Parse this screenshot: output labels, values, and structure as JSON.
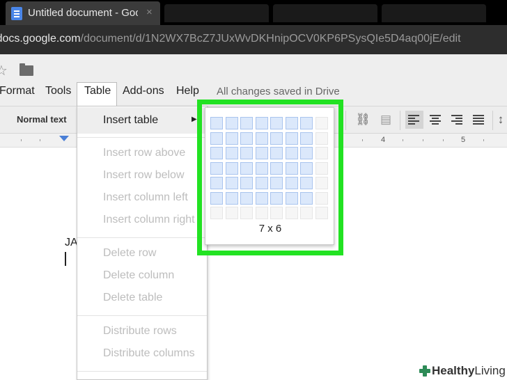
{
  "browser": {
    "tab_title": "Untitled document - Goo",
    "tab_close": "×",
    "url_prefix": "l",
    "url_host": "docs.google.com",
    "url_path": "/document/d/1N2WX7BcZ7JUxWvDKHnipOCV0KP6PSysQIe5D4aq00jE/edit"
  },
  "docs": {
    "menus": [
      "Format",
      "Tools",
      "Table",
      "Add-ons",
      "Help"
    ],
    "save_status": "All changes saved in Drive",
    "style_select": "Normal text",
    "ruler_numbers": [
      "4",
      "5"
    ],
    "doc_text": "JA"
  },
  "table_menu": {
    "insert_table": "Insert table",
    "insert_row_above": "Insert row above",
    "insert_row_below": "Insert row below",
    "insert_column_left": "Insert column left",
    "insert_column_right": "Insert column right",
    "delete_row": "Delete row",
    "delete_column": "Delete column",
    "delete_table": "Delete table",
    "distribute_rows": "Distribute rows",
    "distribute_columns": "Distribute columns"
  },
  "grid_picker": {
    "columns_total": 8,
    "rows_total": 7,
    "selected_columns": 7,
    "selected_rows": 6,
    "size_label": "7 x 6",
    "highlight_color": "#22e222"
  },
  "watermark": {
    "brand_bold": "Healthy",
    "brand_light": "Living"
  }
}
